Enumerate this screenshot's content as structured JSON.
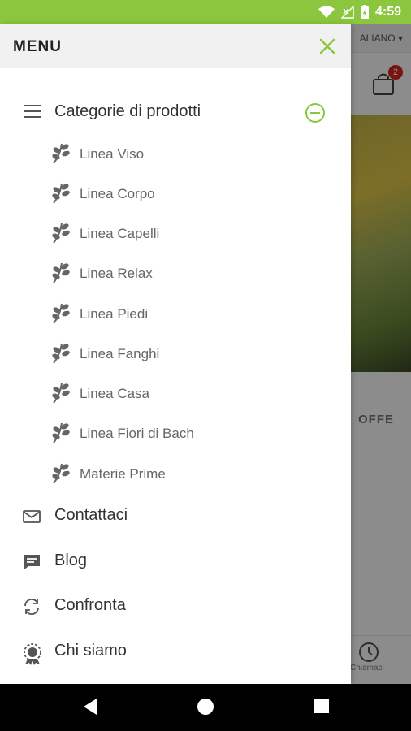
{
  "status_bar": {
    "time": "4:59"
  },
  "background_app": {
    "language": "ALIANO",
    "cart_count": "2",
    "offers_label": "OFFE",
    "call_label": "Chiamaci"
  },
  "drawer": {
    "title": "MENU",
    "categories_label": "Categorie di prodotti",
    "subcategories": [
      "Linea Viso",
      "Linea Corpo",
      "Linea Capelli",
      "Linea Relax",
      "Linea Piedi",
      "Linea Fanghi",
      "Linea Casa",
      "Linea Fiori di Bach",
      "Materie Prime"
    ],
    "items": [
      {
        "label": "Contattaci",
        "icon": "mail-icon"
      },
      {
        "label": "Blog",
        "icon": "chat-icon"
      },
      {
        "label": "Confronta",
        "icon": "compare-icon"
      },
      {
        "label": "Chi siamo",
        "icon": "badge-icon"
      }
    ]
  },
  "colors": {
    "accent": "#8cc63f",
    "status_bar": "#8cc63f",
    "badge": "#d9251d"
  }
}
